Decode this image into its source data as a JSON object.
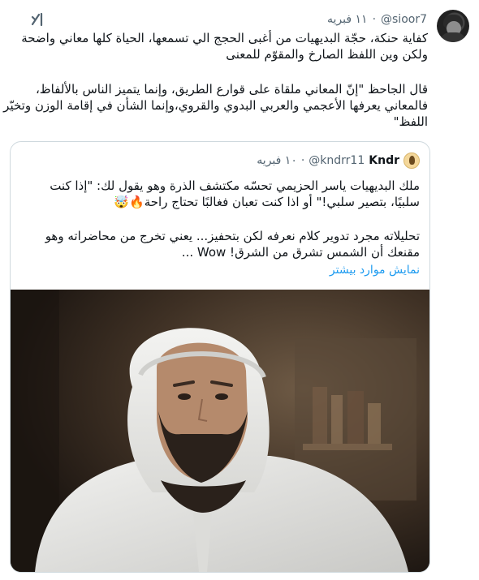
{
  "tweet": {
    "handle": "@sioor7",
    "separator": "·",
    "date": "١١ فبريه",
    "grok_icon": "grok-slash-icon",
    "paragraph1": [
      "كفاية حنكة، حجّة البديهيات من أغبى الحجج الي تسمعها، الحياة كلها معاني واضحة",
      "ولكن وين اللفظ الصارخ والمقوّم للمعنى"
    ],
    "paragraph2": [
      "قال الجاحظ \"إنّ المعاني ملقاة على قوارع الطريق، وإنما يتميز الناس بالألفاظ،",
      "فالمعاني يعرفها الأعجمي والعربي البدوي والقروي،وإنما الشأن في إقامة الوزن وتخيّر",
      "اللفظ\""
    ]
  },
  "quote": {
    "name": "Kndr",
    "handle": "@kndrr11",
    "separator": "·",
    "date": "١٠ فبريه",
    "paragraph1": [
      "ملك البديهيات ياسر الحزيمي تحسّه مكتشف الذرة وهو يقول لك: \"إذا كنت",
      "سلبيًا، بتصير سلبي!\" أو اذا كنت تعبان فغالبًا تحتاج راحة🔥🤯"
    ],
    "paragraph2": [
      "تحليلاته مجرد تدوير كلام نعرفه لكن بتحفيز... يعني تخرج من محاضراته وهو",
      "مقنعك أن الشمس تشرق من الشرق! Wow ..."
    ],
    "show_more": "نمايش موارد بيشتر"
  }
}
